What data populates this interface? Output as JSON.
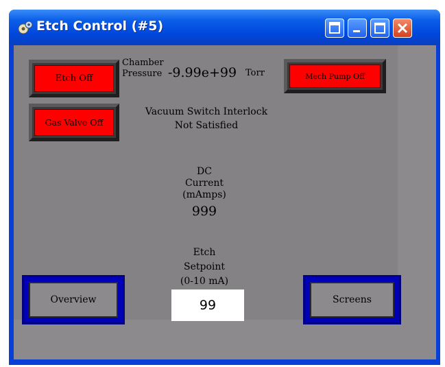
{
  "window": {
    "title": "Etch Control (#5)"
  },
  "buttons": {
    "etch": "Etch Off",
    "gas_valve": "Gas Valve Off",
    "mech_pump": "Mech Pump Off",
    "overview": "Overview",
    "screens": "Screens"
  },
  "pressure": {
    "label_line1": "Chamber",
    "label_line2": "Pressure",
    "value": "-9.99e+99",
    "unit": "Torr"
  },
  "interlock": {
    "line1": "Vacuum Switch Interlock",
    "line2": "Not Satisfied"
  },
  "dc_current": {
    "line1": "DC",
    "line2": "Current",
    "line3": "(mAmps)",
    "value": "999"
  },
  "setpoint": {
    "line1": "Etch",
    "line2": "Setpoint",
    "line3": "(0-10 mA)",
    "value": "99"
  },
  "colors": {
    "alarm_red": "#ff0000",
    "panel_gray": "#848284",
    "nav_blue": "#0000b8",
    "titlebar_blue": "#0047dc"
  }
}
